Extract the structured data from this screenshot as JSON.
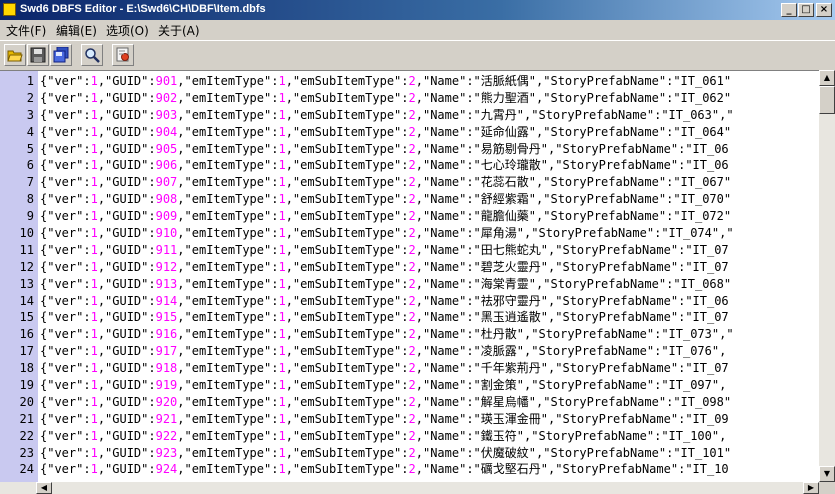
{
  "window": {
    "title": "Swd6 DBFS Editor - E:\\Swd6\\CH\\DBF\\Item.dbfs",
    "min_label": "_",
    "max_label": "□",
    "close_label": "×"
  },
  "menu": [
    {
      "name": "menu-file",
      "label": "文件(F)"
    },
    {
      "name": "menu-edit",
      "label": "编辑(E)"
    },
    {
      "name": "menu-options",
      "label": "选项(O)"
    },
    {
      "name": "menu-about",
      "label": "关于(A)"
    }
  ],
  "toolbar": [
    {
      "name": "open-button",
      "icon": "folder-open-icon"
    },
    {
      "name": "save-button",
      "icon": "disk-icon"
    },
    {
      "name": "save-all-button",
      "icon": "disks-icon"
    },
    {
      "name": "find-button",
      "icon": "magnifier-icon"
    },
    {
      "name": "settings-button",
      "icon": "gear-icon"
    }
  ],
  "rows": [
    {
      "num": "1",
      "guid": "901",
      "sub": "2",
      "item_name": "活脈紙偶",
      "story_tail": "\"IT_061\""
    },
    {
      "num": "2",
      "guid": "902",
      "sub": "2",
      "item_name": "熊力聖酒",
      "story_tail": "\"IT_062\""
    },
    {
      "num": "3",
      "guid": "903",
      "sub": "2",
      "item_name": "九霄丹",
      "story_tail": "\"IT_063\",\""
    },
    {
      "num": "4",
      "guid": "904",
      "sub": "2",
      "item_name": "延命仙露",
      "story_tail": "\"IT_064\""
    },
    {
      "num": "5",
      "guid": "905",
      "sub": "2",
      "item_name": "易筋剔骨丹",
      "story_tail": "\"IT_06"
    },
    {
      "num": "6",
      "guid": "906",
      "sub": "2",
      "item_name": "七心玲瓏散",
      "story_tail": "\"IT_06"
    },
    {
      "num": "7",
      "guid": "907",
      "sub": "2",
      "item_name": "花蕊石散",
      "story_tail": "\"IT_067\""
    },
    {
      "num": "8",
      "guid": "908",
      "sub": "2",
      "item_name": "舒經紫霜",
      "story_tail": "\"IT_070\""
    },
    {
      "num": "9",
      "guid": "909",
      "sub": "2",
      "item_name": "龍膽仙藥",
      "story_tail": "\"IT_072\""
    },
    {
      "num": "10",
      "guid": "910",
      "sub": "2",
      "item_name": "犀角湯",
      "story_tail": "\"IT_074\",\""
    },
    {
      "num": "11",
      "guid": "911",
      "sub": "2",
      "item_name": "田七熊蛇丸",
      "story_tail": "\"IT_07"
    },
    {
      "num": "12",
      "guid": "912",
      "sub": "2",
      "item_name": "碧芝火靈丹",
      "story_tail": "\"IT_07"
    },
    {
      "num": "13",
      "guid": "913",
      "sub": "2",
      "item_name": "海棠青靈",
      "story_tail": "\"IT_068\""
    },
    {
      "num": "14",
      "guid": "914",
      "sub": "2",
      "item_name": "祛邪守靈丹",
      "story_tail": "\"IT_06"
    },
    {
      "num": "15",
      "guid": "915",
      "sub": "2",
      "item_name": "黑玉逍遙散",
      "story_tail": "\"IT_07"
    },
    {
      "num": "16",
      "guid": "916",
      "sub": "2",
      "item_name": "杜丹散",
      "story_tail": "\"IT_073\",\""
    },
    {
      "num": "17",
      "guid": "917",
      "sub": "2",
      "item_name": "凌脈露",
      "story_tail": "\"IT_076\","
    },
    {
      "num": "18",
      "guid": "918",
      "sub": "2",
      "item_name": "千年紫荊丹",
      "story_tail": "\"IT_07"
    },
    {
      "num": "19",
      "guid": "919",
      "sub": "2",
      "item_name": "割金策",
      "story_tail": "\"IT_097\","
    },
    {
      "num": "20",
      "guid": "920",
      "sub": "2",
      "item_name": "解星烏幡",
      "story_tail": "\"IT_098\""
    },
    {
      "num": "21",
      "guid": "921",
      "sub": "2",
      "item_name": "瑛玉渾金冊",
      "story_tail": "\"IT_09"
    },
    {
      "num": "22",
      "guid": "922",
      "sub": "2",
      "item_name": "鐵玉符",
      "story_tail": "\"IT_100\","
    },
    {
      "num": "23",
      "guid": "923",
      "sub": "2",
      "item_name": "伏魔破紋",
      "story_tail": "\"IT_101\""
    },
    {
      "num": "24",
      "guid": "924",
      "sub": "2",
      "item_name": "礪戈堅石丹",
      "story_tail": "\"IT_10"
    }
  ],
  "syntax": {
    "ver_key": "{\"ver\":",
    "ver_val": "1",
    "guid_key": ",\"GUID\":",
    "type_key": ",\"emItemType\":",
    "type_val": "1",
    "sub_key": ",\"emSubItemType\":",
    "name_key": ",\"Name\":",
    "story_key": ",\"StoryPrefabName\":",
    "number_color": "#ff00ff",
    "gutter_color": "#c9c9f0"
  },
  "scrollbar": {
    "up_arrow": "▲",
    "down_arrow": "▼",
    "left_arrow": "◀",
    "right_arrow": "▶"
  }
}
